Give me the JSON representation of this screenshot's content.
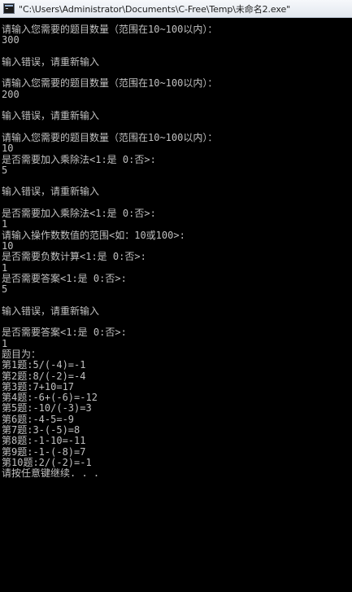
{
  "window": {
    "title": "\"C:\\Users\\Administrator\\Documents\\C-Free\\Temp\\未命名2.exe\"",
    "background": "#000000",
    "text_color": "#c0c0c0"
  },
  "console": {
    "lines": [
      "请输入您需要的题目数量（范围在10~100以内）：",
      "300",
      "",
      "输入错误，请重新输入",
      "",
      "请输入您需要的题目数量（范围在10~100以内）：",
      "200",
      "",
      "输入错误，请重新输入",
      "",
      "请输入您需要的题目数量（范围在10~100以内）：",
      "10",
      "是否需要加入乘除法<1:是 0:否>:",
      "5",
      "",
      "输入错误，请重新输入",
      "",
      "是否需要加入乘除法<1:是 0:否>:",
      "1",
      "请输入操作数数值的范围<如：10或100>:",
      "10",
      "是否需要负数计算<1:是 0:否>:",
      "1",
      "是否需要答案<1:是 0:否>:",
      "5",
      "",
      "输入错误，请重新输入",
      "",
      "是否需要答案<1:是 0:否>:",
      "1",
      "题目为：",
      "第1题:5/(-4)=-1",
      "第2题:8/(-2)=-4",
      "第3题:7+10=17",
      "第4题:-6+(-6)=-12",
      "第5题:-10/(-3)=3",
      "第6题:-4-5=-9",
      "第7题:3-(-5)=8",
      "第8题:-1-10=-11",
      "第9题:-1-(-8)=7",
      "第10题:2/(-2)=-1",
      "请按任意键继续. . ."
    ]
  }
}
